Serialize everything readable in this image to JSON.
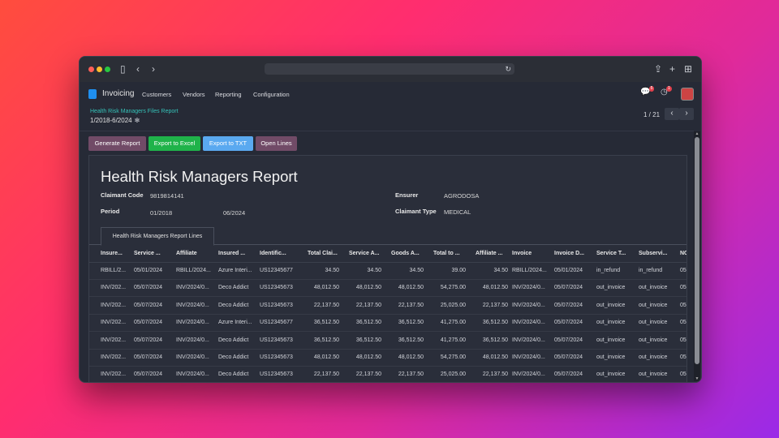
{
  "nav": {
    "app_name": "Invoicing",
    "menu": [
      "Customers",
      "Vendors",
      "Reporting",
      "Configuration"
    ],
    "chat_badge": "5",
    "activity_badge": "1"
  },
  "breadcrumb": {
    "parent": "Health Risk Managers Files Report",
    "current": "1/2018-6/2024"
  },
  "pager": {
    "text": "1 / 21"
  },
  "actions": {
    "generate": "Generate Report",
    "excel": "Export to Excel",
    "txt": "Export to TXT",
    "open_lines": "Open Lines"
  },
  "report": {
    "title": "Health Risk Managers Report",
    "claimant_code_label": "Claimant Code",
    "claimant_code": "9819814141",
    "period_label": "Period",
    "period_from": "01/2018",
    "period_to": "06/2024",
    "ensurer_label": "Ensurer",
    "ensurer": "AGRODOSA",
    "claimant_type_label": "Claimant Type",
    "claimant_type": "MEDICAL",
    "tab_label": "Health Risk Managers Report Lines"
  },
  "table": {
    "headers": [
      "Insure...",
      "Service ...",
      "Affiliate",
      "Insured ...",
      "Identific...",
      "Total Clai...",
      "Service A...",
      "Goods A...",
      "Total to ...",
      "Affiliate ...",
      "Invoice",
      "Invoice D...",
      "Service T...",
      "Subservi...",
      "NC"
    ],
    "rows": [
      [
        "RBILL/2...",
        "05/01/2024",
        "RBILL/2024...",
        "Azure Interi...",
        "US12345677",
        "34.50",
        "34.50",
        "34.50",
        "39.00",
        "34.50",
        "RBILL/2024...",
        "05/01/2024",
        "in_refund",
        "in_refund",
        "05"
      ],
      [
        "INV/202...",
        "05/07/2024",
        "INV/2024/0...",
        "Deco Addict",
        "US12345673",
        "48,012.50",
        "48,012.50",
        "48,012.50",
        "54,275.00",
        "48,012.50",
        "INV/2024/0...",
        "05/07/2024",
        "out_invoice",
        "out_invoice",
        "05"
      ],
      [
        "INV/202...",
        "05/07/2024",
        "INV/2024/0...",
        "Deco Addict",
        "US12345673",
        "22,137.50",
        "22,137.50",
        "22,137.50",
        "25,025.00",
        "22,137.50",
        "INV/2024/0...",
        "05/07/2024",
        "out_invoice",
        "out_invoice",
        "05"
      ],
      [
        "INV/202...",
        "05/07/2024",
        "INV/2024/0...",
        "Azure Interi...",
        "US12345677",
        "36,512.50",
        "36,512.50",
        "36,512.50",
        "41,275.00",
        "36,512.50",
        "INV/2024/0...",
        "05/07/2024",
        "out_invoice",
        "out_invoice",
        "05"
      ],
      [
        "INV/202...",
        "05/07/2024",
        "INV/2024/0...",
        "Deco Addict",
        "US12345673",
        "36,512.50",
        "36,512.50",
        "36,512.50",
        "41,275.00",
        "36,512.50",
        "INV/2024/0...",
        "05/07/2024",
        "out_invoice",
        "out_invoice",
        "05"
      ],
      [
        "INV/202...",
        "05/07/2024",
        "INV/2024/0...",
        "Deco Addict",
        "US12345673",
        "48,012.50",
        "48,012.50",
        "48,012.50",
        "54,275.00",
        "48,012.50",
        "INV/2024/0...",
        "05/07/2024",
        "out_invoice",
        "out_invoice",
        "05"
      ],
      [
        "INV/202...",
        "05/07/2024",
        "INV/2024/0...",
        "Deco Addict",
        "US12345673",
        "22,137.50",
        "22,137.50",
        "22,137.50",
        "25,025.00",
        "22,137.50",
        "INV/2024/0...",
        "05/07/2024",
        "out_invoice",
        "out_invoice",
        "05"
      ]
    ]
  },
  "colors": {
    "generate": "#714b67",
    "excel": "#1fb34a",
    "txt": "#5aa9f0",
    "open_lines": "#714b67",
    "link": "#35c2b8"
  }
}
